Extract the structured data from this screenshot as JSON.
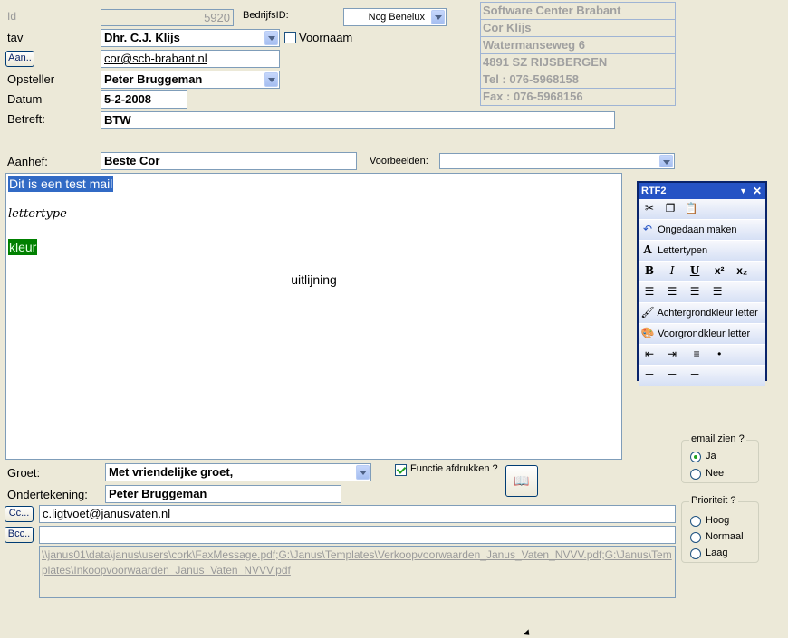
{
  "header": {
    "id_label": "Id",
    "id_value": "5920",
    "bedrijfsid_label": "BedrijfsID:",
    "bedrijfsid_value": "Ncg Benelux",
    "tav_label": "tav",
    "tav_value": "Dhr. C.J. Klijs",
    "voornaam_label": "Voornaam",
    "aan_button": "Aan..",
    "aan_value": "cor@scb-brabant.nl",
    "opsteller_label": "Opsteller",
    "opsteller_value": "Peter Bruggeman",
    "datum_label": "Datum",
    "datum_value": "5-2-2008",
    "betreft_label": "Betreft:",
    "betreft_value": "BTW"
  },
  "address": [
    "Software Center Brabant",
    "Cor Klijs",
    "Watermanseweg 6",
    "4891 SZ RIJSBERGEN",
    "Tel : 076-5968158",
    "Fax : 076-5968156"
  ],
  "aanhef": {
    "label": "Aanhef:",
    "value": "Beste Cor",
    "voorbeelden_label": "Voorbeelden:",
    "voorbeelden_value": ""
  },
  "editor": {
    "line1": "Dit is een test mail",
    "line2": "lettertype",
    "line3": "kleur",
    "line4": "uitlijning"
  },
  "rtf": {
    "title": "RTF2",
    "undo": "Ongedaan maken",
    "fonts": "Lettertypen",
    "bg_color": "Achtergrondkleur letter",
    "fg_color": "Voorgrondkleur letter"
  },
  "footer": {
    "groet_label": "Groet:",
    "groet_value": "Met vriendelijke groet,",
    "functie_label": "Functie afdrukken ?",
    "ondertekening_label": "Ondertekening:",
    "ondertekening_value": "Peter Bruggeman",
    "cc_button": "Cc...",
    "cc_value": "c.ligtvoet@janusvaten.nl",
    "bcc_button": "Bcc..",
    "bcc_value": "",
    "attachments": "\\\\janus01\\data\\janus\\users\\cork\\FaxMessage.pdf;G:\\Janus\\Templates\\Verkoopvoorwaarden_Janus_Vaten_NVVV.pdf;G:\\Janus\\Templates\\Inkoopvoorwaarden_Janus_Vaten_NVVV.pdf"
  },
  "email_group": {
    "title": "email zien ?",
    "ja": "Ja",
    "nee": "Nee"
  },
  "prio_group": {
    "title": "Prioriteit ?",
    "hoog": "Hoog",
    "normaal": "Normaal",
    "laag": "Laag"
  },
  "colors": {
    "selection": "#316ac5",
    "kleur_bg": "#008000",
    "toolbar_title": "#2553c4"
  }
}
